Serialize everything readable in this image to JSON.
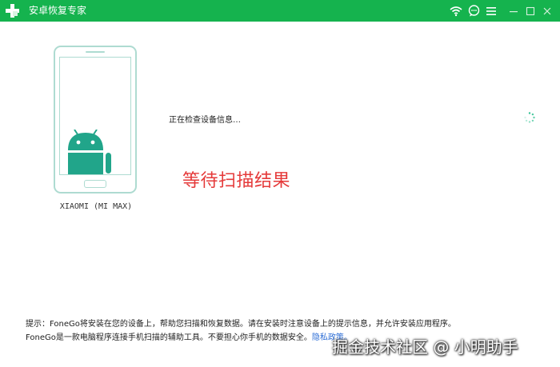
{
  "window": {
    "title": "安卓恢复专家",
    "accent_color": "#15b34e",
    "controls": [
      "wifi-icon",
      "chat-icon",
      "menu-icon",
      "minimize-icon",
      "maximize-icon",
      "close-icon"
    ]
  },
  "device": {
    "name": "XIAOMI (MI MAX)"
  },
  "scan": {
    "status": "正在检查设备信息…"
  },
  "overlay": {
    "caption": "等待扫描结果"
  },
  "footer": {
    "tip": "提示：FoneGo将安装在您的设备上，帮助您扫描和恢复数据。请在安装时注意设备上的提示信息，并允许安装应用程序。",
    "description": "FoneGo是一款电脑程序连接手机扫描的辅助工具。不要担心你手机的数据安全。",
    "privacy_link": "隐私政策。"
  },
  "watermark": {
    "text": "掘金技术社区 @ 小明助手"
  }
}
